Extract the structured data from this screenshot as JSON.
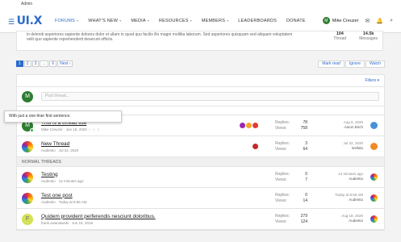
{
  "adminbar": {
    "label": "Admin"
  },
  "nav": {
    "logo": "UI.X",
    "items": [
      {
        "label": "FORUMS",
        "has_chevron": true,
        "active": true
      },
      {
        "label": "WHAT'S NEW",
        "has_chevron": true
      },
      {
        "label": "MEDIA",
        "has_chevron": true
      },
      {
        "label": "RESOURCES",
        "has_chevron": true
      },
      {
        "label": "MEMBERS",
        "has_chevron": true
      },
      {
        "label": "LEADERBOARDS",
        "has_chevron": false
      },
      {
        "label": "DONATE",
        "has_chevron": false
      }
    ],
    "user_name": "Mike Creuzer",
    "user_initial": "M"
  },
  "topcard": {
    "line1": "in deleniti asperiores sapiente dolores dolor et ullam in quod quo facilis illo magni mollitia laborum. Sed asperiores quisquam sed aliquam voluptatem",
    "line2": "velit quo sapiente reprehenderit deserunt officiis.",
    "threads_value": "104",
    "threads_label": "Thread",
    "messages_value": "14.5k",
    "messages_label": "Messages"
  },
  "pager": {
    "pages": [
      "1",
      "2",
      "3",
      "…",
      "6"
    ],
    "next": "Next ›"
  },
  "actions": {
    "mark_read": "Mark read",
    "ignore": "Ignore",
    "watch": "Watch"
  },
  "filters": {
    "label": "Filters ▾"
  },
  "post": {
    "avatar_initial": "M",
    "placeholder": "Post thread..."
  },
  "tooltip": {
    "text": "With just a one-liner first sentence."
  },
  "sticky_threads": [
    {
      "title": "This is a thread title",
      "author": "Mike Creuzer",
      "date": "Jun 18, 2020",
      "replies": "78",
      "views": "758",
      "last_date": "Aug 6, 2020",
      "last_user": "Aaron Birch",
      "avatar": "green",
      "avatar_initial": "M",
      "last_avatar_color": "#4a90d9",
      "badges": [
        "#9c27b0",
        "#f9a825",
        "#e53935"
      ]
    },
    {
      "title": "New Thread",
      "author": "Audentio",
      "date": "Jul 22, 2020",
      "replies": "3",
      "views": "64",
      "last_date": "Jul 22, 2020",
      "last_user": "lostfalo",
      "avatar": "rainbow",
      "avatar_initial": "",
      "last_avatar_color": "#f08a24",
      "badges": [
        "#c62828"
      ]
    }
  ],
  "normal_section": "NORMAL THREADS",
  "normal_threads": [
    {
      "title": "Testing",
      "author": "Audentio",
      "date": "14 minutes ago",
      "replies": "0",
      "views": "7",
      "last_date": "14 minutes ago",
      "last_user": "Audentio",
      "avatar": "rainbow",
      "avatar_initial": ""
    },
    {
      "title": "Test one post",
      "author": "Audentio",
      "date": "Today at 8:55 AM",
      "replies": "0",
      "views": "14",
      "last_date": "Today at 8:55 AM",
      "last_user": "Audentio",
      "avatar": "rainbow",
      "avatar_initial": ""
    },
    {
      "title": "Quidem provident perferendis nesciunt doloribus.",
      "author": "frank.swaniawski",
      "date": "Jun 18, 2018",
      "replies": "279",
      "views": "124",
      "last_date": "Aug 18, 2020",
      "last_user": "Audentio",
      "avatar": "yellow",
      "avatar_initial": "F"
    }
  ],
  "labels": {
    "replies": "Replies:",
    "views": "Views:"
  }
}
